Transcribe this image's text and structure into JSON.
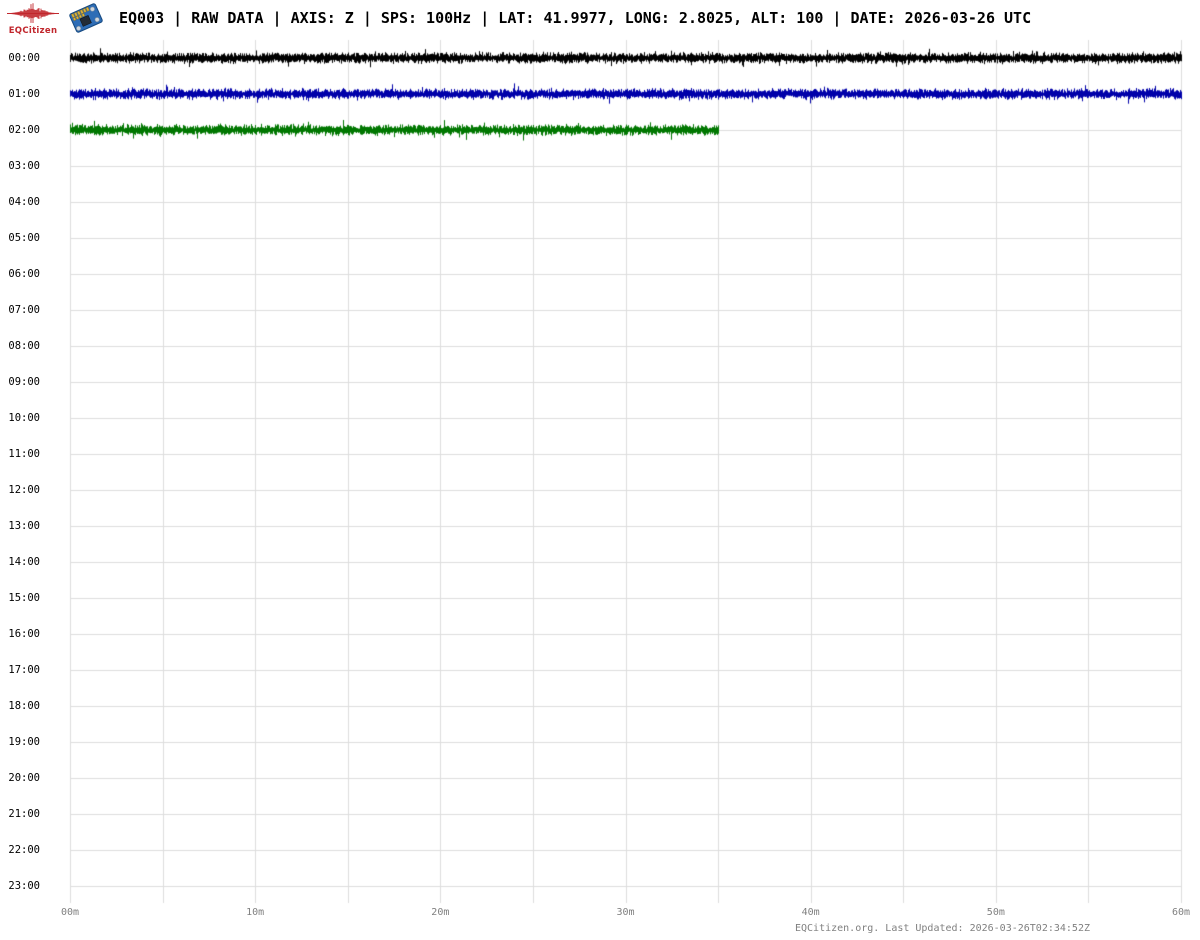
{
  "header": {
    "logo_text": "EQCitizen",
    "title": "EQ003 | RAW DATA | AXIS: Z | SPS: 100Hz | LAT: 41.9977, LONG: 2.8025, ALT: 100 | DATE: 2026-03-26 UTC"
  },
  "footer": {
    "credit": "EQCitizen.org. Last Updated: 2026-03-26T02:34:52Z"
  },
  "chart_data": {
    "type": "line",
    "subtype": "helicorder-dayplot",
    "title": "EQ003 raw Z-axis data, 100Hz, 2026-03-26 UTC",
    "station": "EQ003",
    "axis": "Z",
    "sps": "100Hz",
    "lat": "41.9977",
    "long": "2.8025",
    "alt": "100",
    "date_utc": "2026-03-26",
    "x_axis": {
      "ticks": [
        "00m",
        "10m",
        "20m",
        "30m",
        "40m",
        "50m",
        "60m"
      ],
      "range_minutes": [
        0,
        60
      ],
      "major_tick_minutes": 10,
      "grid_interval_minutes": 5
    },
    "y_axis": {
      "ticks": [
        "00:00",
        "01:00",
        "02:00",
        "03:00",
        "04:00",
        "05:00",
        "06:00",
        "07:00",
        "08:00",
        "09:00",
        "10:00",
        "11:00",
        "12:00",
        "13:00",
        "14:00",
        "15:00",
        "16:00",
        "17:00",
        "18:00",
        "19:00",
        "20:00",
        "21:00",
        "22:00",
        "23:00"
      ],
      "rows": 24
    },
    "grid": {
      "on": true,
      "color": "#dddddd"
    },
    "traces": [
      {
        "hour": "00:00",
        "row": 0,
        "color": "#000000",
        "start_min": 0,
        "end_min": 60,
        "signal": "continuous background noise, no events",
        "seed": 101
      },
      {
        "hour": "01:00",
        "row": 1,
        "color": "#0000aa",
        "start_min": 0,
        "end_min": 60,
        "signal": "continuous background noise, no events",
        "seed": 202
      },
      {
        "hour": "02:00",
        "row": 2,
        "color": "#007700",
        "start_min": 0,
        "end_min": 35,
        "signal": "continuous background noise, recording stops at ~02:35 UTC",
        "seed": 303
      }
    ],
    "empty_rows": [
      "03:00",
      "04:00",
      "05:00",
      "06:00",
      "07:00",
      "08:00",
      "09:00",
      "10:00",
      "11:00",
      "12:00",
      "13:00",
      "14:00",
      "15:00",
      "16:00",
      "17:00",
      "18:00",
      "19:00",
      "20:00",
      "21:00",
      "22:00",
      "23:00"
    ]
  }
}
